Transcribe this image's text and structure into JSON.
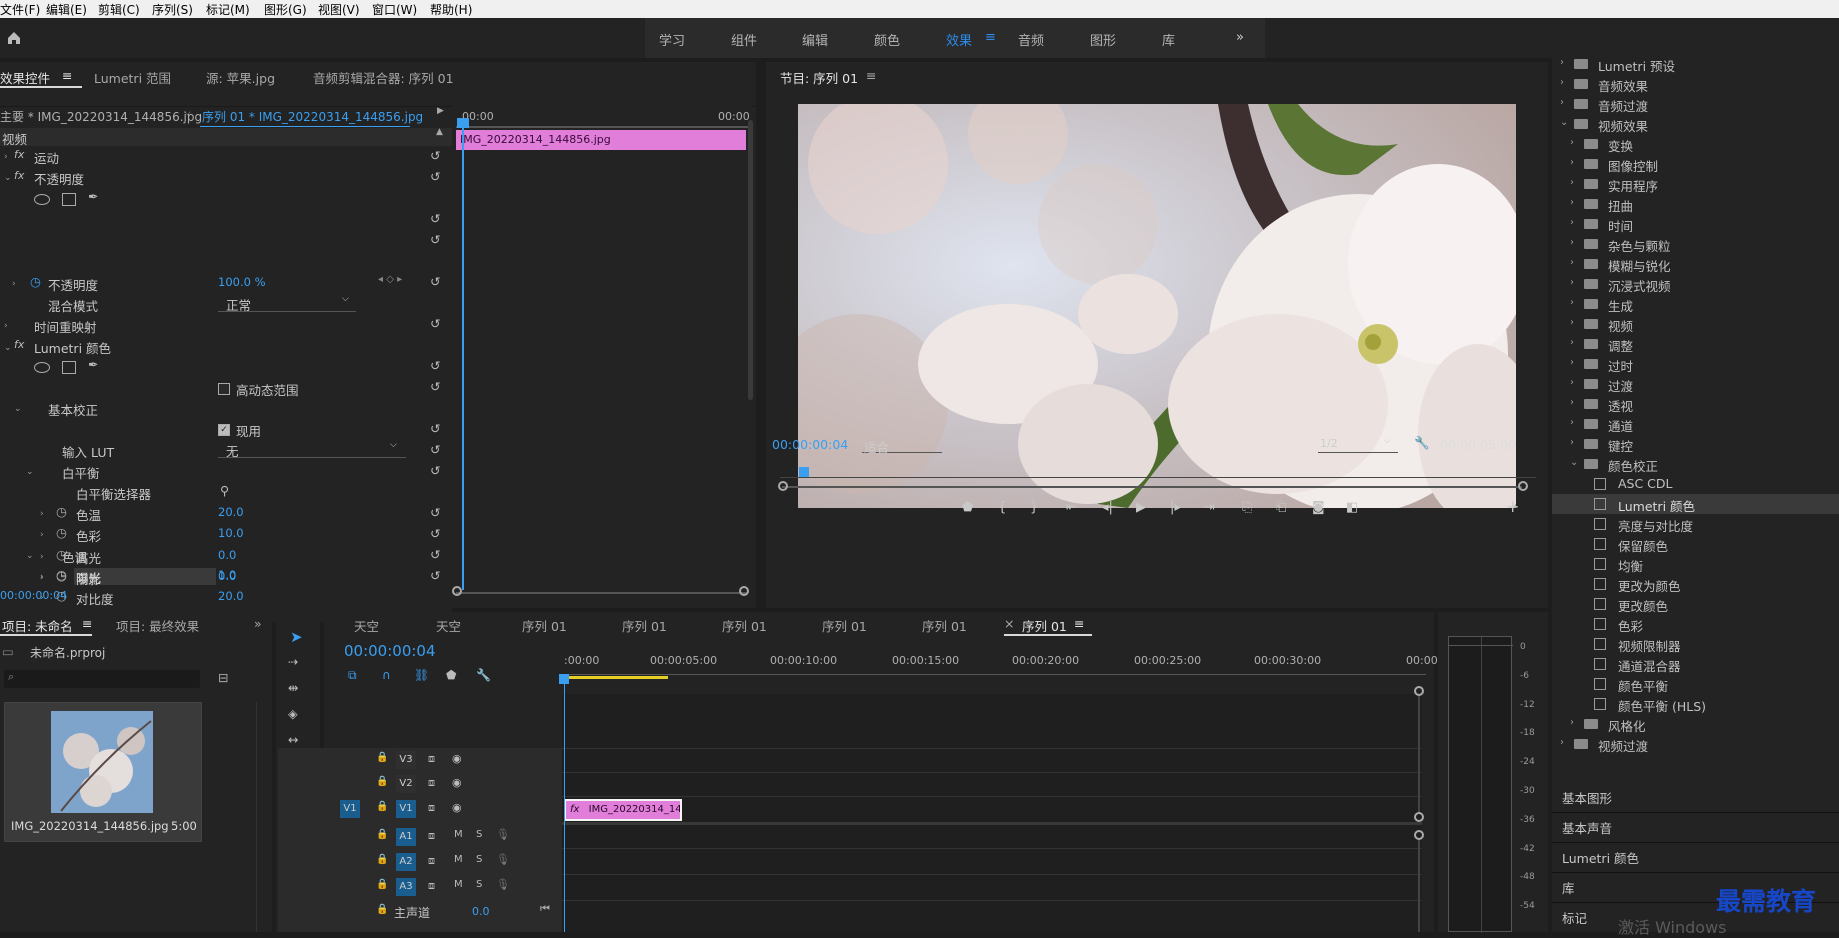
{
  "menu": [
    "文件(F)",
    "编辑(E)",
    "剪辑(C)",
    "序列(S)",
    "标记(M)",
    "图形(G)",
    "视图(V)",
    "窗口(W)",
    "帮助(H)"
  ],
  "workspaces": [
    "学习",
    "组件",
    "编辑",
    "颜色",
    "效果",
    "音频",
    "图形",
    "库"
  ],
  "active_workspace": "效果",
  "effect_controls": {
    "tabs": [
      "效果控件",
      "Lumetri 范围",
      "源: 苹果.jpg",
      "音频剪辑混合器: 序列 01"
    ],
    "master": "主要 * IMG_20220314_144856.jpg",
    "sequence": "序列 01 * IMG_20220314_144856.jpg",
    "time_start": "00:00",
    "time_end": "00:00",
    "clip_name": "IMG_20220314_144856.jpg",
    "section": "视频",
    "rows": {
      "motion": "运动",
      "opacity": "不透明度",
      "opacity_prop": "不透明度",
      "opacity_value": "100.0 %",
      "blend_mode": "混合模式",
      "blend_value": "正常",
      "time_remap": "时间重映射",
      "lumetri": "Lumetri 颜色",
      "hdr": "高动态范围",
      "basic": "基本校正",
      "enable": "现用",
      "input_lut": "输入 LUT",
      "lut_value": "无",
      "white_balance": "白平衡",
      "wb_picker": "白平衡选择器",
      "temp": "色温",
      "temp_value": "20.0",
      "tint": "色彩",
      "tint_value": "10.0",
      "tone": "色调",
      "exposure": "曝光",
      "exposure_value": "1.0",
      "contrast": "对比度",
      "contrast_value": "20.0",
      "highlights": "高光",
      "highlights_value": "0.0",
      "shadows": "阴影",
      "shadows_value": "0.0"
    },
    "fx": "fx",
    "timecode": "00:00:00:04"
  },
  "program": {
    "title": "节目: 序列 01",
    "timecode": "00:00:00:04",
    "fit": "适合",
    "resolution": "1/2",
    "duration": "00:00:05:00"
  },
  "effects_tree": {
    "items": [
      {
        "label": "Lumetri 预设",
        "level": 0,
        "type": "folder"
      },
      {
        "label": "音频效果",
        "level": 0,
        "type": "folder"
      },
      {
        "label": "音频过渡",
        "level": 0,
        "type": "folder"
      },
      {
        "label": "视频效果",
        "level": 0,
        "type": "folder",
        "open": true
      },
      {
        "label": "变换",
        "level": 1,
        "type": "folder"
      },
      {
        "label": "图像控制",
        "level": 1,
        "type": "folder"
      },
      {
        "label": "实用程序",
        "level": 1,
        "type": "folder"
      },
      {
        "label": "扭曲",
        "level": 1,
        "type": "folder"
      },
      {
        "label": "时间",
        "level": 1,
        "type": "folder"
      },
      {
        "label": "杂色与颗粒",
        "level": 1,
        "type": "folder"
      },
      {
        "label": "模糊与锐化",
        "level": 1,
        "type": "folder"
      },
      {
        "label": "沉浸式视频",
        "level": 1,
        "type": "folder"
      },
      {
        "label": "生成",
        "level": 1,
        "type": "folder"
      },
      {
        "label": "视频",
        "level": 1,
        "type": "folder"
      },
      {
        "label": "调整",
        "level": 1,
        "type": "folder"
      },
      {
        "label": "过时",
        "level": 1,
        "type": "folder"
      },
      {
        "label": "过渡",
        "level": 1,
        "type": "folder"
      },
      {
        "label": "透视",
        "level": 1,
        "type": "folder"
      },
      {
        "label": "通道",
        "level": 1,
        "type": "folder"
      },
      {
        "label": "键控",
        "level": 1,
        "type": "folder"
      },
      {
        "label": "颜色校正",
        "level": 1,
        "type": "folder",
        "open": true
      },
      {
        "label": "ASC CDL",
        "level": 2,
        "type": "effect"
      },
      {
        "label": "Lumetri 颜色",
        "level": 2,
        "type": "effect",
        "selected": true
      },
      {
        "label": "亮度与对比度",
        "level": 2,
        "type": "effect"
      },
      {
        "label": "保留颜色",
        "level": 2,
        "type": "effect"
      },
      {
        "label": "均衡",
        "level": 2,
        "type": "effect"
      },
      {
        "label": "更改为颜色",
        "level": 2,
        "type": "effect"
      },
      {
        "label": "更改颜色",
        "level": 2,
        "type": "effect"
      },
      {
        "label": "色彩",
        "level": 2,
        "type": "effect"
      },
      {
        "label": "视频限制器",
        "level": 2,
        "type": "effect"
      },
      {
        "label": "通道混合器",
        "level": 2,
        "type": "effect"
      },
      {
        "label": "颜色平衡",
        "level": 2,
        "type": "effect"
      },
      {
        "label": "颜色平衡 (HLS)",
        "level": 2,
        "type": "effect"
      },
      {
        "label": "风格化",
        "level": 1,
        "type": "folder"
      },
      {
        "label": "视频过渡",
        "level": 0,
        "type": "folder"
      }
    ],
    "bottom_panels": [
      "基本图形",
      "基本声音",
      "Lumetri 颜色",
      "库",
      "标记"
    ]
  },
  "project": {
    "tabs": [
      "项目: 未命名",
      "项目: 最终效果"
    ],
    "file": "未命名.prproj",
    "thumb_name": "IMG_20220314_144856.jpg",
    "thumb_duration": "5:00"
  },
  "timeline": {
    "tabs": [
      "天空",
      "天空",
      "序列 01",
      "序列 01",
      "序列 01",
      "序列 01",
      "序列 01",
      "序列 01"
    ],
    "timecode": "00:00:00:04",
    "ruler": [
      ":00:00",
      "00:00:05:00",
      "00:00:10:00",
      "00:00:15:00",
      "00:00:20:00",
      "00:00:25:00",
      "00:00:30:00",
      "00:00"
    ],
    "video_tracks": [
      "V3",
      "V2",
      "V1"
    ],
    "source_patch": "V1",
    "audio_tracks": [
      "A1",
      "A2",
      "A3"
    ],
    "master": "主声道",
    "master_value": "0.0",
    "clip": "IMG_20220314_144",
    "m": "M",
    "s": "S"
  },
  "meter_ticks": [
    "0",
    "-6",
    "-12",
    "-18",
    "-24",
    "-30",
    "-36",
    "-42",
    "-48",
    "-54"
  ],
  "watermark": "最需教育",
  "activate": "激活 Windows"
}
